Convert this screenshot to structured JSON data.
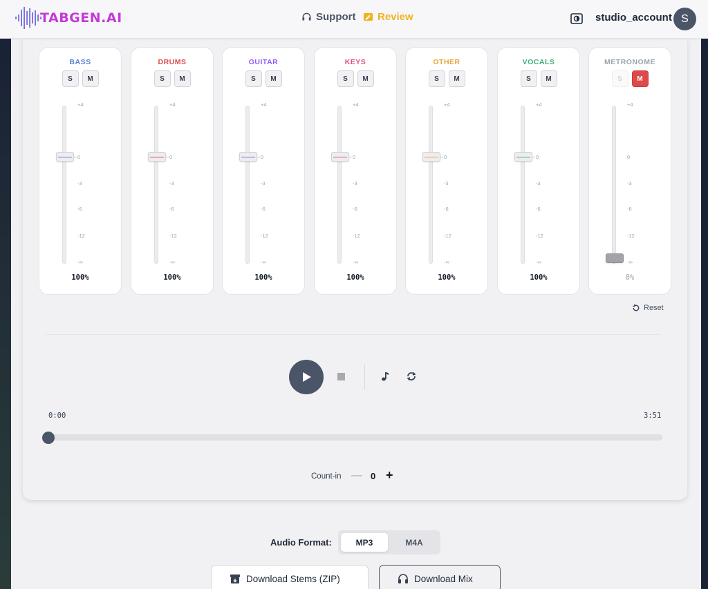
{
  "header": {
    "logo_text": "TABGEN.AI",
    "nav": [
      {
        "label": "Support",
        "icon": "headset-icon"
      },
      {
        "label": "Review",
        "icon": "review-edit-icon",
        "color": "#f0b323"
      }
    ],
    "account_name": "studio_account",
    "avatar_letter": "S"
  },
  "mixer": {
    "scale": [
      "+4",
      "0",
      "-3",
      "-6",
      "-12",
      "-∞"
    ],
    "strips": [
      {
        "name": "BASS",
        "color": "#5b7fd6",
        "solo": "S",
        "mute": "M",
        "volume_label": "100%",
        "volume": 100,
        "muted": false
      },
      {
        "name": "DRUMS",
        "color": "#d94c4c",
        "solo": "S",
        "mute": "M",
        "volume_label": "100%",
        "volume": 100,
        "muted": false
      },
      {
        "name": "GUITAR",
        "color": "#8b5cf6",
        "solo": "S",
        "mute": "M",
        "volume_label": "100%",
        "volume": 100,
        "muted": false
      },
      {
        "name": "KEYS",
        "color": "#e0507a",
        "solo": "S",
        "mute": "M",
        "volume_label": "100%",
        "volume": 100,
        "muted": false
      },
      {
        "name": "OTHER",
        "color": "#e8a43a",
        "solo": "S",
        "mute": "M",
        "volume_label": "100%",
        "volume": 100,
        "muted": false
      },
      {
        "name": "VOCALS",
        "color": "#3fae76",
        "solo": "S",
        "mute": "M",
        "volume_label": "100%",
        "volume": 100,
        "muted": false
      },
      {
        "name": "METRONOME",
        "color": "#9ca3af",
        "solo": "S",
        "mute": "M",
        "volume_label": "0%",
        "volume": 0,
        "muted": true
      }
    ],
    "reset_label": "Reset"
  },
  "transport": {
    "time_start": "0:00",
    "time_end": "3:51",
    "progress": 0,
    "countin_label": "Count-in",
    "countin_value": "0"
  },
  "export": {
    "format_label": "Audio Format:",
    "formats": [
      "MP3",
      "M4A"
    ],
    "selected_format": "MP3",
    "download_stems": "Download Stems (ZIP)",
    "download_mix": "Download Mix"
  },
  "colors": {
    "accent": "#4a5568",
    "review": "#f0b323",
    "mute_active": "#dc4a4a"
  }
}
